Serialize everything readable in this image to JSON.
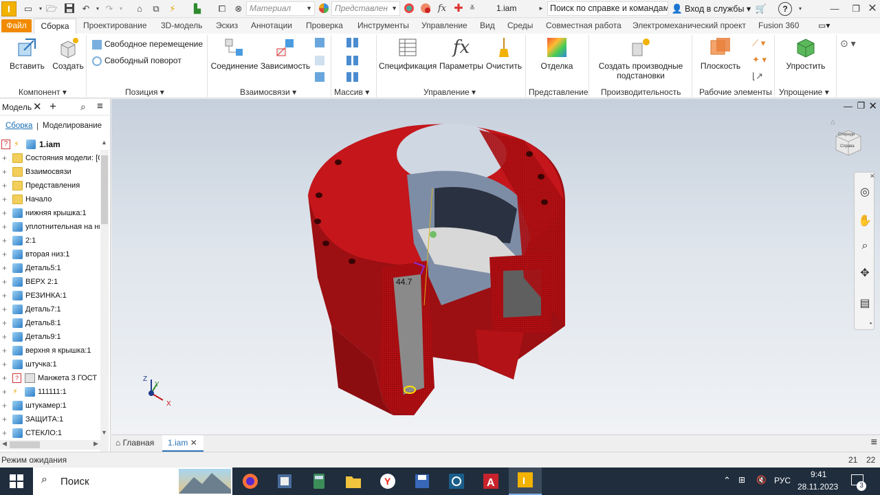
{
  "app": {
    "logo": "I",
    "material_placeholder": "Материал",
    "representation_placeholder": "Представлен",
    "fx_icon": "fx",
    "doc_title": "1.iam",
    "search_text": "Поиск по справке и командам.",
    "signin": "Вход в службы",
    "help": "?"
  },
  "tabs": {
    "file": "Файл",
    "active": "Сборка",
    "items": [
      "Проектирование",
      "3D-модель",
      "Эскиз",
      "Аннотации",
      "Проверка",
      "Инструменты",
      "Управление",
      "Вид",
      "Среды",
      "Совместная работа",
      "Электромеханический проект",
      "Fusion 360"
    ]
  },
  "ribbon": {
    "component": {
      "insert": "Вставить",
      "create": "Создать",
      "title": "Компонент"
    },
    "position": {
      "free_move": "Свободное перемещение",
      "free_rotate": "Свободный поворот",
      "title": "Позиция"
    },
    "relations": {
      "joint": "Соединение",
      "constraint": "Зависимость",
      "title": "Взаимосвязи"
    },
    "pattern": {
      "title": "Массив"
    },
    "manage": {
      "bom": "Спецификация",
      "params": "Параметры",
      "params_icon": "fx",
      "clean": "Очистить",
      "title": "Управление"
    },
    "represent": {
      "finish": "Отделка",
      "title": "Представление"
    },
    "productivity": {
      "derived_1": "Создать производные",
      "derived_2": "подстановки",
      "title": "Производительность"
    },
    "work_features": {
      "plane": "Плоскость",
      "title": "Рабочие элементы"
    },
    "simplify": {
      "simplify": "Упростить",
      "title": "Упрощение"
    }
  },
  "browser": {
    "tab": "Модель",
    "subtab_assembly": "Сборка",
    "subtab_modeling": "Моделирование",
    "root": "1.iam",
    "items": [
      {
        "label": "Состояния модели: [О",
        "icon": "folder"
      },
      {
        "label": "Взаимосвязи",
        "icon": "folder"
      },
      {
        "label": "Представления",
        "icon": "folder"
      },
      {
        "label": "Начало",
        "icon": "folder"
      },
      {
        "label": "нижняя крышка:1",
        "icon": "part"
      },
      {
        "label": "уплотнительная на ни",
        "icon": "part"
      },
      {
        "label": "2:1",
        "icon": "part"
      },
      {
        "label": "вторая низ:1",
        "icon": "part"
      },
      {
        "label": "Деталь5:1",
        "icon": "part"
      },
      {
        "label": "ВЕРХ 2:1",
        "icon": "part"
      },
      {
        "label": "РЕЗИНКА:1",
        "icon": "part"
      },
      {
        "label": "Деталь7:1",
        "icon": "part"
      },
      {
        "label": "Деталь8:1",
        "icon": "part"
      },
      {
        "label": "Деталь9:1",
        "icon": "part"
      },
      {
        "label": "верхня я крышка:1",
        "icon": "part"
      },
      {
        "label": "штучка:1",
        "icon": "part"
      },
      {
        "label": "Манжета 3 ГОСТ :",
        "icon": "warn-part"
      },
      {
        "label": "111111:1",
        "icon": "lightning-part"
      },
      {
        "label": "штукамер:1",
        "icon": "part"
      },
      {
        "label": "ЗАЩИТА:1",
        "icon": "part"
      },
      {
        "label": "СТЕКЛО:1",
        "icon": "part"
      }
    ]
  },
  "viewport": {
    "dimension_label": "44.7",
    "viewcube_front": "Спереди",
    "viewcube_right": "Справа",
    "axis_x": "X",
    "axis_y": "Y",
    "axis_z": "Z"
  },
  "doc_tabs": {
    "home": "Главная",
    "doc": "1.iam"
  },
  "status": {
    "text": "Режим ожидания",
    "n1": "21",
    "n2": "22"
  },
  "taskbar": {
    "search": "Поиск",
    "lang": "РУС",
    "time": "9:41",
    "date": "28.11.2023",
    "notif": "3"
  }
}
